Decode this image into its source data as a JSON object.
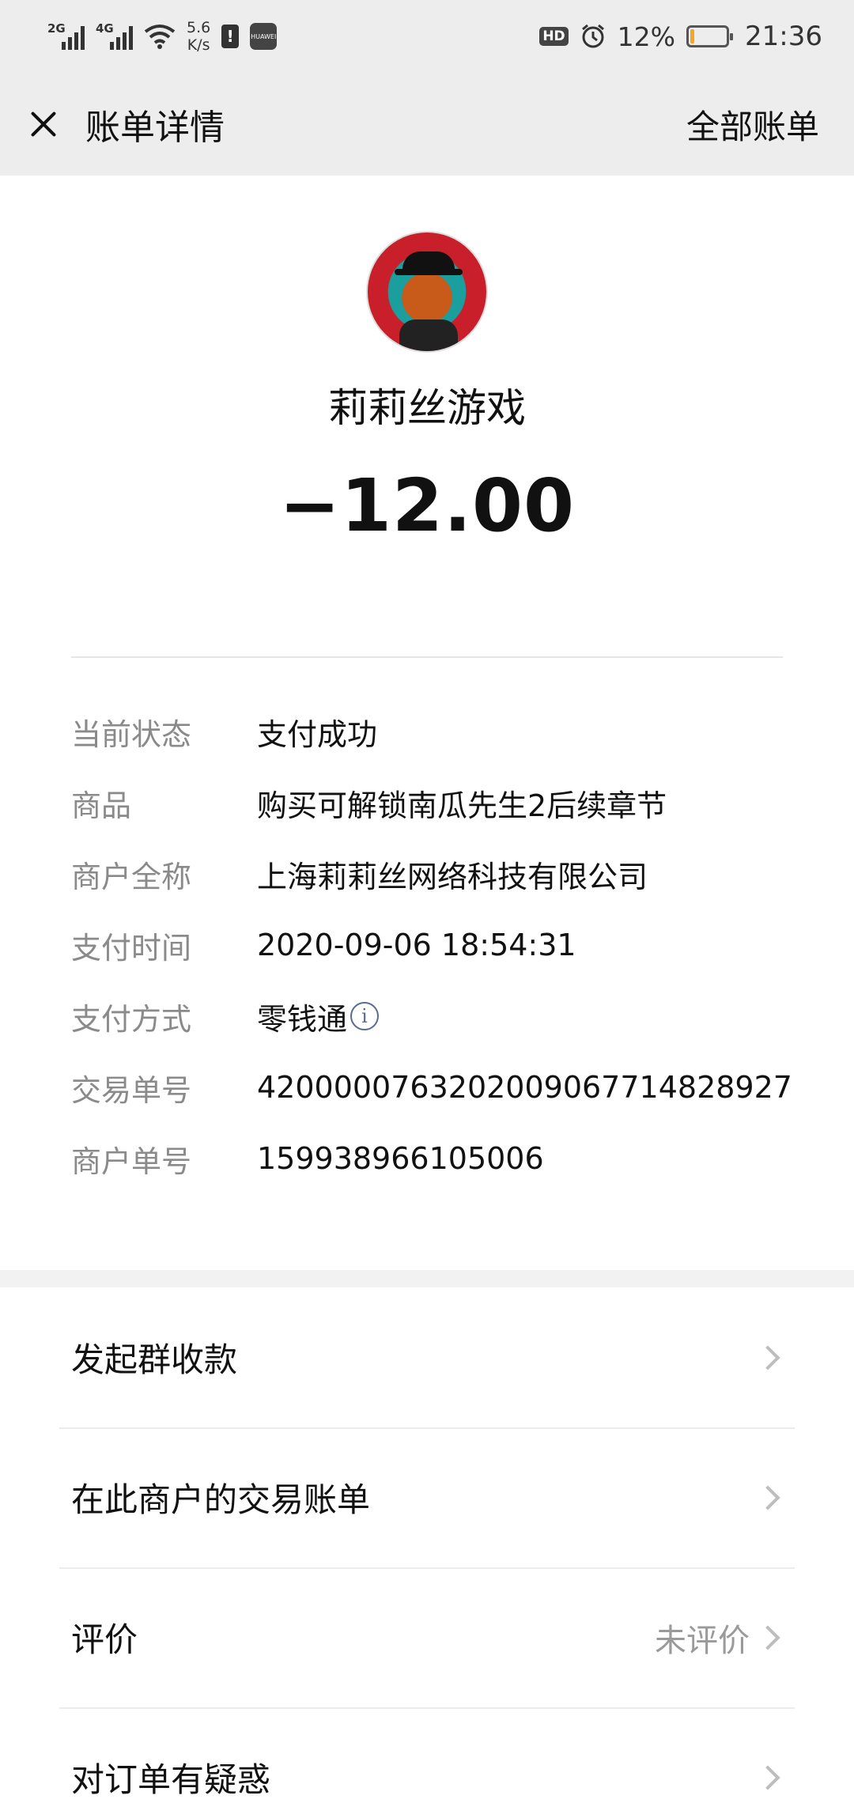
{
  "status_bar": {
    "net1": "2G",
    "net2": "4G",
    "speed_value": "5.6",
    "speed_unit": "K/s",
    "notify_glyph": "!",
    "huawei": "HUAWEI",
    "hd": "HD",
    "battery_pct": "12%",
    "battery_level": 0.12,
    "time": "21:36"
  },
  "nav": {
    "title": "账单详情",
    "right_link": "全部账单"
  },
  "merchant": {
    "name": "莉莉丝游戏",
    "amount": "−12.00"
  },
  "details": [
    {
      "label": "当前状态",
      "value": "支付成功"
    },
    {
      "label": "商品",
      "value": "购买可解锁南瓜先生2后续章节"
    },
    {
      "label": "商户全称",
      "value": "上海莉莉丝网络科技有限公司"
    },
    {
      "label": "支付时间",
      "value": "2020-09-06 18:54:31"
    },
    {
      "label": "支付方式",
      "value": "零钱通"
    },
    {
      "label": "交易单号",
      "value": "4200000763202009067714828927"
    },
    {
      "label": "商户单号",
      "value": "159938966105006"
    }
  ],
  "info_glyph": "i",
  "menu": [
    {
      "label": "发起群收款",
      "sub": ""
    },
    {
      "label": "在此商户的交易账单",
      "sub": ""
    },
    {
      "label": "评价",
      "sub": "未评价"
    },
    {
      "label": "对订单有疑惑",
      "sub": ""
    }
  ],
  "colors": {
    "nav_bg": "#ededed",
    "link_blue": "#576b95",
    "label_gray": "#8a8a8a",
    "battery_orange": "#f5a623"
  }
}
